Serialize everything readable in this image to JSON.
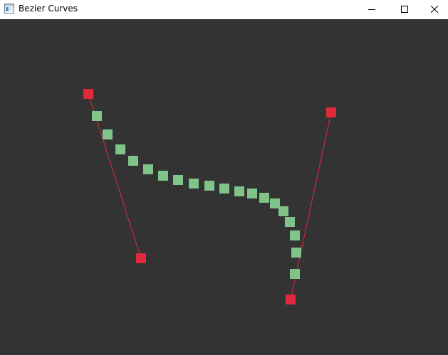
{
  "window": {
    "title": "Bezier Curves",
    "icon": "app-window-icon"
  },
  "controls": [
    {
      "name": "minimize-button",
      "icon": "minimize-icon"
    },
    {
      "name": "maximize-button",
      "icon": "maximize-icon"
    },
    {
      "name": "close-button",
      "icon": "close-icon"
    }
  ],
  "colors": {
    "titlebar_bg": "#ffffff",
    "canvas_bg": "#333333",
    "control_point": "#e0293b",
    "handle_line": "#e0293b",
    "curve_point": "#80c48a"
  }
}
